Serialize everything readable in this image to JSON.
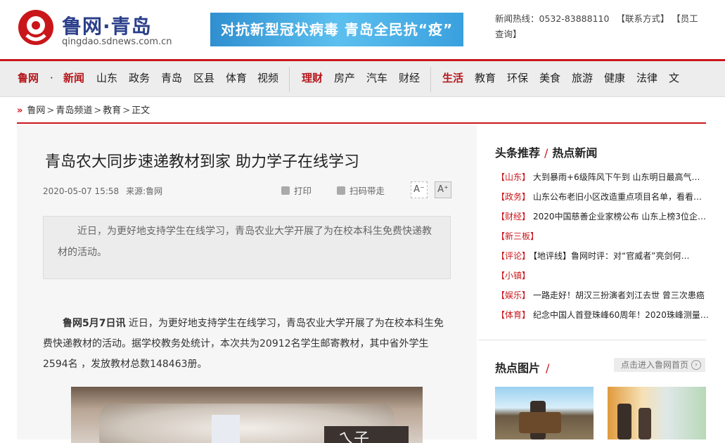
{
  "header": {
    "logo_title": "鲁网·青岛",
    "logo_url": "qingdao.sdnews.com.cn",
    "banner_text": "对抗新型冠状病毒 青岛全民抗“疫”",
    "hotline": "新闻热线：0532-83888110",
    "contact": "【联系方式】",
    "staff": "【员工查询】"
  },
  "nav": {
    "items": [
      "鲁网",
      "·",
      "新闻",
      "山东",
      "政务",
      "青岛",
      "区县",
      "体育",
      "视频",
      "理财",
      "房产",
      "汽车",
      "财经",
      "生活",
      "教育",
      "环保",
      "美食",
      "旅游",
      "健康",
      "法律",
      "文"
    ]
  },
  "breadcrumb": {
    "items": [
      "鲁网",
      "青岛频道",
      "教育",
      "正文"
    ],
    "sep": ">"
  },
  "article": {
    "title": "青岛农大同步速递教材到家 助力学子在线学习",
    "datetime": "2020-05-07 15:58",
    "source": "来源:鲁网",
    "print_label": "打印",
    "qr_label": "扫码带走",
    "font_smaller": "A⁻",
    "font_larger": "A⁺",
    "summary": "近日，为更好地支持学生在线学习，青岛农业大学开展了为在校本科生免费快递教材的活动。",
    "lead": "鲁网5月7日讯",
    "body": " 近日，为更好地支持学生在线学习，青岛农业大学开展了为在校本科生免费快递教材的活动。据学校教务处统计，本次共为20912名学生邮寄教材，其中省外学生2594名 ，发放教材总数148463册。"
  },
  "sidebar": {
    "head_a": "头条推荐",
    "head_b": "热点新闻",
    "news": [
      {
        "cat": "【山东】",
        "text": "大到暴雨+6级阵风下午到  山东明日最高气…"
      },
      {
        "cat": "【政务】",
        "text": "山东公布老旧小区改造重点项目名单，看看…"
      },
      {
        "cat": "【财经】",
        "text": "2020中国慈善企业家榜公布  山东上榜3位企…"
      },
      {
        "cat": "【新三板】",
        "text": ""
      },
      {
        "cat": "【评论】",
        "text": "【地评线】鲁网时评：对“官威者”亮剑何…"
      },
      {
        "cat": "【小镇】",
        "text": ""
      },
      {
        "cat": "【娱乐】",
        "text": "一路走好！胡汉三扮演者刘江去世 曾三次患癌"
      },
      {
        "cat": "【体育】",
        "text": "纪念中国人首登珠峰60周年！2020珠峰测量…"
      }
    ],
    "pics_head": "热点图片",
    "home_link": "点击进入鲁网首页"
  }
}
